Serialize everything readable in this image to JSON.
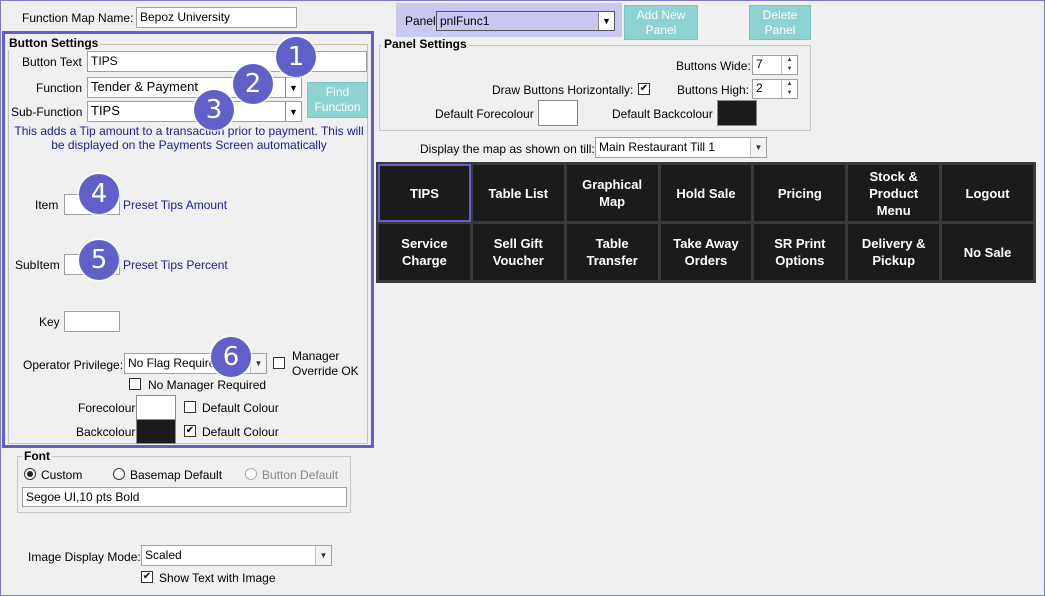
{
  "header": {
    "function_map_label": "Function Map Name:",
    "function_map_value": "Bepoz University"
  },
  "panel": {
    "label": "Panel",
    "selected": "pnlFunc1",
    "add_button": "Add New Panel",
    "delete_button": "Delete Panel"
  },
  "panel_settings": {
    "title": "Panel Settings",
    "buttons_wide_label": "Buttons Wide:",
    "buttons_wide_value": "7",
    "draw_horizontally_label": "Draw Buttons Horizontally:",
    "draw_horizontally_checked": true,
    "buttons_high_label": "Buttons High:",
    "buttons_high_value": "2",
    "default_forecolour_label": "Default Forecolour",
    "default_backcolour_label": "Default Backcolour",
    "forecolour_hex": "#ffffff",
    "backcolour_hex": "#1b1b1b"
  },
  "till": {
    "label": "Display the map as shown on till:",
    "selected": "Main Restaurant Till 1"
  },
  "button_settings": {
    "title": "Button Settings",
    "button_text_label": "Button Text",
    "button_text_value": "TIPS",
    "function_label": "Function",
    "function_value": "Tender & Payment",
    "subfunction_label": "Sub-Function",
    "subfunction_value": "TIPS",
    "find_function_button": "Find Function",
    "description": "This adds a Tip amount to a transaction prior to payment. This will be displayed on the Payments Screen automatically",
    "item_label": "Item",
    "item_link": "Preset Tips Amount",
    "subitem_label": "SubItem",
    "subitem_link": "Preset Tips Percent",
    "key_label": "Key",
    "operator_privilege_label": "Operator Privilege:",
    "operator_privilege_value": "No Flag Required",
    "manager_override_label": "Manager Override OK",
    "no_manager_required_label": "No Manager Required",
    "forecolour_label": "Forecolour",
    "backcolour_label": "Backcolour",
    "default_colour_label": "Default Colour",
    "default_colour_label_2": "Default Colour"
  },
  "font": {
    "title": "Font",
    "custom_label": "Custom",
    "basemap_label": "Basemap Default",
    "button_default_label": "Button Default",
    "value": "Segoe UI,10 pts Bold"
  },
  "image": {
    "mode_label": "Image Display Mode:",
    "mode_value": "Scaled",
    "show_text_label": "Show Text with Image"
  },
  "badges": [
    "1",
    "2",
    "3",
    "4",
    "5",
    "6"
  ],
  "function_buttons": [
    {
      "label": "TIPS"
    },
    {
      "label": "Table List"
    },
    {
      "label": "Graphical\nMap"
    },
    {
      "label": "Hold Sale"
    },
    {
      "label": "Pricing"
    },
    {
      "label": "Stock &\nProduct\nMenu"
    },
    {
      "label": "Logout"
    },
    {
      "label": "Service\nCharge"
    },
    {
      "label": "Sell Gift\nVoucher"
    },
    {
      "label": "Table\nTransfer"
    },
    {
      "label": "Take Away\nOrders"
    },
    {
      "label": "SR Print\nOptions"
    },
    {
      "label": "Delivery &\nPickup"
    },
    {
      "label": "No Sale"
    }
  ],
  "colors": {
    "accent": "#6060c8",
    "teal": "#8dd3d1",
    "panel_select": "#c8c8f0",
    "button_bg": "#1b1b1b"
  }
}
